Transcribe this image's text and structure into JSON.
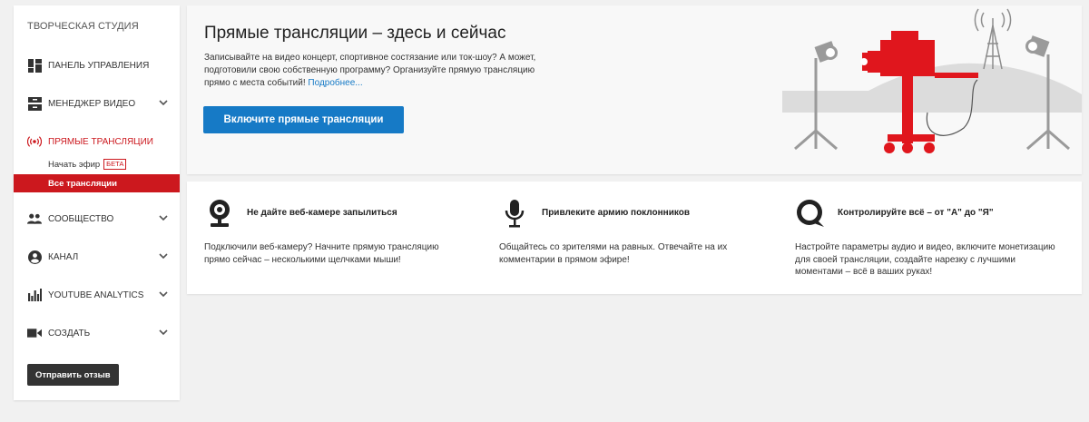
{
  "sidebar": {
    "title": "ТВОРЧЕСКАЯ СТУДИЯ",
    "items": [
      {
        "label": "ПАНЕЛЬ УПРАВЛЕНИЯ",
        "icon": "dashboard-icon"
      },
      {
        "label": "МЕНЕДЖЕР ВИДЕО",
        "icon": "video-manager-icon"
      },
      {
        "label": "ПРЯМЫЕ ТРАНСЛЯЦИИ",
        "icon": "live-broadcast-icon"
      },
      {
        "label": "СООБЩЕСТВО",
        "icon": "community-icon"
      },
      {
        "label": "КАНАЛ",
        "icon": "channel-icon"
      },
      {
        "label": "YOUTUBE ANALYTICS",
        "icon": "analytics-icon"
      },
      {
        "label": "СОЗДАТЬ",
        "icon": "create-video-icon"
      }
    ],
    "live_sub": {
      "start_label": "Начать эфир",
      "beta": "БЕТА",
      "all_label": "Все трансляции"
    },
    "feedback_label": "Отправить отзыв",
    "accent_color": "#cc181e"
  },
  "hero": {
    "title": "Прямые трансляции – здесь и сейчас",
    "description": "Записывайте на видео концерт, спортивное состязание или ток-шоу? А может, подготовили свою собственную программу? Организуйте прямую трансляцию прямо с места событий!",
    "more_link": "Подробнее...",
    "button_label": "Включите прямые трансляции",
    "button_color": "#167ac6"
  },
  "features": [
    {
      "icon": "webcam-icon",
      "title": "Не дайте веб-камере запылиться",
      "description": "Подключили веб-камеру? Начните прямую трансляцию прямо сейчас – несколькими щелчками мыши!"
    },
    {
      "icon": "microphone-icon",
      "title": "Привлеките армию поклонников",
      "description": "Общайтесь со зрителями на равных. Отвечайте на их комментарии в прямом эфире!"
    },
    {
      "icon": "chat-bubble-icon",
      "title": "Контролируйте всё – от \"А\" до \"Я\"",
      "description": "Настройте параметры аудио и видео, включите монетизацию для своей трансляции, создайте нарезку с лучшими моментами – всё в ваших руках!"
    }
  ]
}
